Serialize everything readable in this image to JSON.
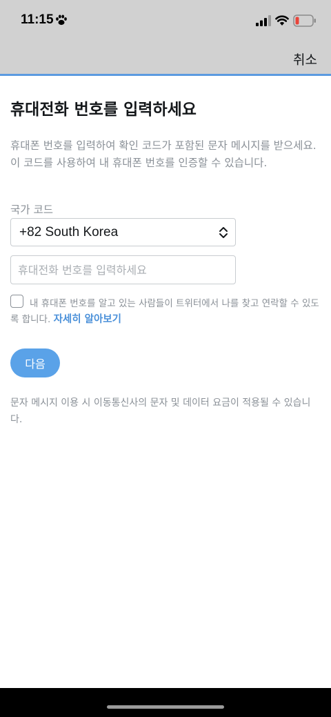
{
  "status_bar": {
    "time": "11:15",
    "icons": [
      "paw-icon",
      "cellular-signal-icon",
      "wifi-icon",
      "battery-low-icon"
    ],
    "battery_color": "#e8443a"
  },
  "nav": {
    "cancel_label": "취소",
    "accent_color": "#5b9ae0"
  },
  "main": {
    "title": "휴대전화 번호를 입력하세요",
    "description": "휴대폰 번호를 입력하여 확인 코드가 포함된 문자 메시지를 받으세요. 이 코드를 사용하여 내 휴대폰 번호를 인증할 수 있습니다.",
    "country_code_label": "국가 코드",
    "country_code_value": "+82 South Korea",
    "phone_placeholder": "휴대전화 번호를 입력하세요",
    "phone_value": "",
    "discoverable_checked": false,
    "discoverable_text": "내 휴대폰 번호를 알고 있는 사람들이 트위터에서 나를 찾고 연락할 수 있도록 합니다.",
    "learn_more_label": "자세히 알아보기",
    "next_label": "다음",
    "next_color": "#5aa2e8",
    "footnote": "문자 메시지 이용 시 이동통신사의 문자 및 데이터 요금이 적용될 수 있습니다."
  }
}
